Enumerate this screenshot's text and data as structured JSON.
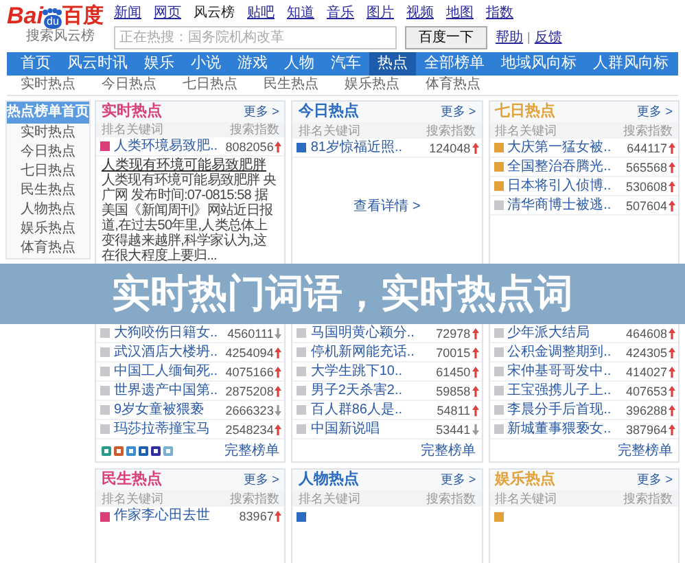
{
  "logo": {
    "wordmark_left": "Bai",
    "paw_text": "du",
    "wordmark_right": "百度",
    "subtitle": "搜索风云榜"
  },
  "top_links": [
    {
      "label": "新闻",
      "selected": false
    },
    {
      "label": "网页",
      "selected": false
    },
    {
      "label": "风云榜",
      "selected": true
    },
    {
      "label": "贴吧",
      "selected": false
    },
    {
      "label": "知道",
      "selected": false
    },
    {
      "label": "音乐",
      "selected": false
    },
    {
      "label": "图片",
      "selected": false
    },
    {
      "label": "视频",
      "selected": false
    },
    {
      "label": "地图",
      "selected": false
    },
    {
      "label": "指数",
      "selected": false
    }
  ],
  "search": {
    "placeholder": "正在热搜：国务院机构改革",
    "button": "百度一下"
  },
  "help_links": [
    "帮助",
    "反馈"
  ],
  "help_separator": "|",
  "main_nav": [
    {
      "label": "首页",
      "selected": false
    },
    {
      "label": "风云时讯",
      "selected": false
    },
    {
      "label": "娱乐",
      "selected": false
    },
    {
      "label": "小说",
      "selected": false
    },
    {
      "label": "游戏",
      "selected": false
    },
    {
      "label": "人物",
      "selected": false
    },
    {
      "label": "汽车",
      "selected": false
    },
    {
      "label": "热点",
      "selected": true
    },
    {
      "label": "全部榜单",
      "selected": false
    },
    {
      "label": "地域风向标",
      "selected": false
    },
    {
      "label": "人群风向标",
      "selected": false
    }
  ],
  "sub_nav": [
    "实时热点",
    "今日热点",
    "七日热点",
    "民生热点",
    "娱乐热点",
    "体育热点"
  ],
  "sidebar": [
    {
      "label": "热点榜单首页",
      "selected": true
    },
    {
      "label": "实时热点",
      "selected": false
    },
    {
      "label": "今日热点",
      "selected": false
    },
    {
      "label": "七日热点",
      "selected": false
    },
    {
      "label": "民生热点",
      "selected": false
    },
    {
      "label": "人物热点",
      "selected": false
    },
    {
      "label": "娱乐热点",
      "selected": false
    },
    {
      "label": "体育热点",
      "selected": false
    }
  ],
  "banner": "实时热门词语，实时热点词",
  "top_cards": [
    {
      "title": "实时热点",
      "color": "#d9407a",
      "more": "更多 >",
      "columns": [
        "排名",
        "关键词",
        "搜索指数"
      ],
      "rows": [
        {
          "highlight": true,
          "keyword": "人类环境易致肥..",
          "value": "8082056",
          "rising": true
        }
      ],
      "snippet": {
        "title": "人类现有环境可能易致肥胖",
        "text": "人类现有环境可能易致肥胖 央广网 发布时间:07-0815:58 据美国《新闻周刊》网站近日报道,在过去50年里,人类总体上变得越来越胖,科学家认为,这在很大程度上要归..."
      },
      "lower_rows": [
        {
          "highlight": false,
          "keyword": "大狗咬伤日籍女..",
          "value": "4560111",
          "rising": false
        },
        {
          "highlight": false,
          "keyword": "武汉酒店大楼坍..",
          "value": "4254094",
          "rising": true
        },
        {
          "highlight": false,
          "keyword": "中国工人缅甸死..",
          "value": "4075166",
          "rising": true
        },
        {
          "highlight": false,
          "keyword": "世界遗产中国第..",
          "value": "2875208",
          "rising": true
        },
        {
          "highlight": false,
          "keyword": "9岁女童被猥亵",
          "value": "2666323",
          "rising": false
        },
        {
          "highlight": false,
          "keyword": "玛莎拉蒂撞宝马",
          "value": "2548234",
          "rising": true
        }
      ],
      "share_icons": true,
      "footer_link": "完整榜单"
    },
    {
      "title": "今日热点",
      "color": "#2a6cc0",
      "more": "更多 >",
      "columns": [
        "排名",
        "关键词",
        "搜索指数"
      ],
      "rows": [
        {
          "highlight": true,
          "keyword": "81岁惊福近照..",
          "value": "124048",
          "rising": true
        }
      ],
      "detail_link": "查看详情 >",
      "lower_rows": [
        {
          "highlight": false,
          "keyword": "马国明黄心颖分..",
          "value": "72978",
          "rising": true
        },
        {
          "highlight": false,
          "keyword": "停机新网能充话..",
          "value": "70015",
          "rising": true
        },
        {
          "highlight": false,
          "keyword": "大学生跳下10..",
          "value": "61450",
          "rising": true
        },
        {
          "highlight": false,
          "keyword": "男子2天杀害2..",
          "value": "59858",
          "rising": true
        },
        {
          "highlight": false,
          "keyword": "百人群86人是..",
          "value": "54811",
          "rising": true
        },
        {
          "highlight": false,
          "keyword": "中国新说唱",
          "value": "53441",
          "rising": false
        }
      ],
      "share_icons": false,
      "footer_link": "完整榜单"
    },
    {
      "title": "七日热点",
      "color": "#e3a13a",
      "more": "更多 >",
      "columns": [
        "排名",
        "关键词",
        "搜索指数"
      ],
      "rows": [
        {
          "highlight": true,
          "keyword": "大庆第一猛女被..",
          "value": "644117",
          "rising": true
        },
        {
          "highlight": true,
          "keyword": "全国整治吞腾光..",
          "value": "565568",
          "rising": true
        },
        {
          "highlight": true,
          "keyword": "日本将引入侦博..",
          "value": "530608",
          "rising": true
        },
        {
          "highlight": false,
          "keyword": "清华商博士被逃..",
          "value": "507604",
          "rising": true
        }
      ],
      "lower_rows": [
        {
          "highlight": false,
          "keyword": "少年派大结局",
          "value": "464608",
          "rising": true
        },
        {
          "highlight": false,
          "keyword": "公积金调整期到..",
          "value": "424305",
          "rising": true
        },
        {
          "highlight": false,
          "keyword": "宋仲基哥哥发中..",
          "value": "414027",
          "rising": true
        },
        {
          "highlight": false,
          "keyword": "王宝强携儿子上..",
          "value": "407653",
          "rising": true
        },
        {
          "highlight": false,
          "keyword": "李晨分手后首现..",
          "value": "396288",
          "rising": true
        },
        {
          "highlight": false,
          "keyword": "新城董事猥亵女..",
          "value": "387964",
          "rising": true
        }
      ],
      "share_icons": false,
      "footer_link": "完整榜单"
    }
  ],
  "bottom_cards": [
    {
      "title": "民生热点",
      "color": "#d9407a",
      "more": "更多 >",
      "columns": [
        "排名",
        "关键词",
        "搜索指数"
      ],
      "rows": [
        {
          "highlight": true,
          "keyword": "作家李心田去世",
          "value": "83967",
          "rising": true
        }
      ]
    },
    {
      "title": "人物热点",
      "color": "#2a6cc0",
      "more": "更多 >",
      "columns": [
        "排名",
        "关键词",
        "搜索指数"
      ],
      "rows": [
        {
          "highlight": true
        }
      ]
    },
    {
      "title": "娱乐热点",
      "color": "#e3a13a",
      "more": "更多 >",
      "columns": [
        "排名",
        "关键词",
        "搜索指数"
      ],
      "rows": [
        {
          "highlight": true
        }
      ]
    }
  ]
}
